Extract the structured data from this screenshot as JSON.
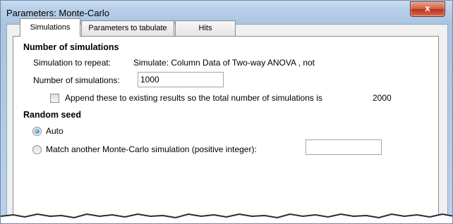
{
  "window": {
    "title": "Parameters: Monte-Carlo",
    "close_symbol": "x"
  },
  "tabs": [
    {
      "label": "Simulations",
      "active": true
    },
    {
      "label": "Parameters to tabulate",
      "active": false
    },
    {
      "label": "Hits",
      "active": false
    }
  ],
  "simulations": {
    "heading": "Number of simulations",
    "repeat_label": "Simulation to repeat:",
    "repeat_value": "Simulate: Column Data of Two-way ANOVA , not",
    "count_label": "Number of simulations:",
    "count_value": "1000",
    "append_label": "Append these to existing results so the total number of simulations is",
    "append_checked": false,
    "total_value": "2000"
  },
  "random_seed": {
    "heading": "Random seed",
    "auto_label": "Auto",
    "auto_selected": true,
    "match_label": "Match another Monte-Carlo simulation (positive integer):",
    "match_selected": false,
    "match_value": ""
  },
  "colors": {
    "title_bar": "#b7cfe8",
    "close_button": "#c9462b",
    "panel": "#ffffff",
    "radio_dot": "#1f6fb8"
  }
}
